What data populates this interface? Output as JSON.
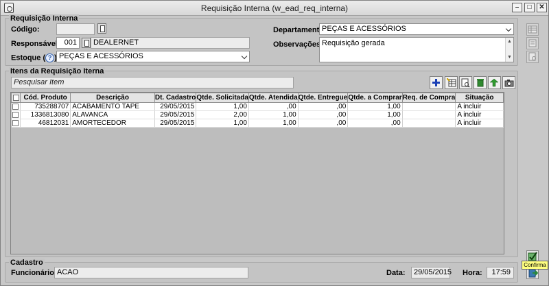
{
  "window": {
    "title": "Requisição Interna (w_ead_req_interna)"
  },
  "header_group": {
    "title": "Requisição Interna",
    "codigo_label": "Código:",
    "codigo_value": "",
    "responsavel_label": "Responsável:",
    "responsavel_code": "001",
    "responsavel_name": "DEALERNET",
    "estoque_label_prefix": "Estoque (",
    "estoque_help": "?",
    "estoque_label_suffix": "):",
    "estoque_value": "PEÇAS E ACESSÓRIOS",
    "departamento_label": "Departamento:",
    "departamento_value": "PEÇAS E ACESSÓRIOS",
    "observacoes_label": "Observações:",
    "observacoes_value": "Requisição gerada"
  },
  "items_group": {
    "title": "Itens da Requisição Iterna",
    "search_placeholder": "Pesquisar Item",
    "columns": [
      "",
      "Cód. Produto",
      "Descrição",
      "Dt. Cadastro",
      "Qtde. Solicitada",
      "Qtde. Atendida",
      "Qtde. Entregue",
      "Qtde. a Comprar",
      "Req. de Compra",
      "Situação"
    ],
    "rows": [
      {
        "codigo": "735288707",
        "descricao": "ACABAMENTO TAPE",
        "dt_cadastro": "29/05/2015",
        "solicitada": "1,00",
        "atendida": ",00",
        "entregue": ",00",
        "a_comprar": "1,00",
        "req_compra": "",
        "situacao": "A incluir"
      },
      {
        "codigo": "1336813080",
        "descricao": "ALAVANCA",
        "dt_cadastro": "29/05/2015",
        "solicitada": "2,00",
        "atendida": "1,00",
        "entregue": ",00",
        "a_comprar": "1,00",
        "req_compra": "",
        "situacao": "A incluir"
      },
      {
        "codigo": "46812031",
        "descricao": "AMORTECEDOR",
        "dt_cadastro": "29/05/2015",
        "solicitada": "1,00",
        "atendida": "1,00",
        "entregue": ",00",
        "a_comprar": ",00",
        "req_compra": "",
        "situacao": "A incluir"
      }
    ]
  },
  "footer_group": {
    "title": "Cadastro",
    "funcionario_label": "Funcionário:",
    "funcionario_value": "ACAO",
    "data_label": "Data:",
    "data_value": "29/05/2015",
    "hora_label": "Hora:",
    "hora_value": "17:59"
  },
  "tooltip": {
    "text": "Confirma"
  },
  "colors": {
    "add": "#1a3fb5",
    "delete": "#2f8a2f",
    "confirm": "#2a8a3a"
  }
}
